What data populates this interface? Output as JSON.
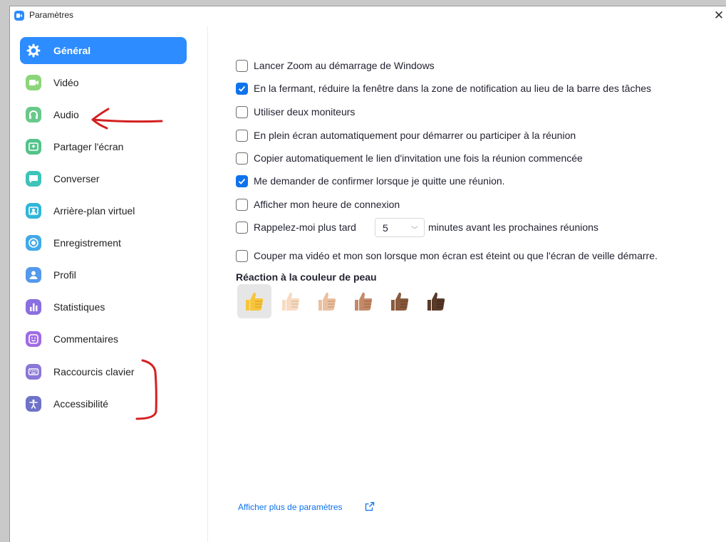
{
  "window": {
    "title": "Paramètres",
    "close_glyph": "✕"
  },
  "sidebar": {
    "items": [
      {
        "label": "Général",
        "icon": "gear-icon",
        "color": "#2d8cff",
        "active": true
      },
      {
        "label": "Vidéo",
        "icon": "video-camera-icon",
        "color": "#8dd57a"
      },
      {
        "label": "Audio",
        "icon": "headphones-icon",
        "color": "#67c98a"
      },
      {
        "label": "Partager l'écran",
        "icon": "share-screen-icon",
        "color": "#54c38a"
      },
      {
        "label": "Converser",
        "icon": "chat-bubble-icon",
        "color": "#3ec3b8"
      },
      {
        "label": "Arrière-plan virtuel",
        "icon": "virtual-background-icon",
        "color": "#31b6d8"
      },
      {
        "label": "Enregistrement",
        "icon": "record-icon",
        "color": "#42a9e8"
      },
      {
        "label": "Profil",
        "icon": "profile-icon",
        "color": "#5399ec"
      },
      {
        "label": "Statistiques",
        "icon": "statistics-icon",
        "color": "#8a6fe0"
      },
      {
        "label": "Commentaires",
        "icon": "feedback-smiley-icon",
        "color": "#9f6be4"
      },
      {
        "label": "Raccourcis clavier",
        "icon": "keyboard-icon",
        "color": "#8a77d8"
      },
      {
        "label": "Accessibilité",
        "icon": "accessibility-icon",
        "color": "#6f72c9"
      }
    ]
  },
  "general": {
    "options": [
      {
        "label": "Lancer Zoom au démarrage de Windows",
        "checked": false
      },
      {
        "label": "En la fermant, réduire la fenêtre dans la zone de notification au lieu de la barre des tâches",
        "checked": true
      },
      {
        "label": "Utiliser deux moniteurs",
        "checked": false
      },
      {
        "label": "En plein écran automatiquement pour démarrer ou participer à la réunion",
        "checked": false
      },
      {
        "label": "Copier automatiquement le lien d'invitation une fois la réunion commencée",
        "checked": false
      },
      {
        "label": "Me demander de confirmer lorsque je quitte une réunion.",
        "checked": true
      },
      {
        "label": "Afficher mon heure de connexion",
        "checked": false
      }
    ],
    "reminder": {
      "label_before": "Rappelez-moi plus tard",
      "select_value": "5",
      "label_after": "minutes avant les prochaines réunions",
      "checked": false
    },
    "mute_option": {
      "label": "Couper ma vidéo et mon son lorsque mon écran est éteint ou que l'écran de veille démarre.",
      "checked": false
    },
    "skin_tone": {
      "heading": "Réaction à la couleur de peau",
      "tones": [
        "#f7c53c",
        "#f7dbc2",
        "#eac0a0",
        "#c48a68",
        "#8a5a3c",
        "#5a3a28"
      ],
      "selected_index": 0
    },
    "more_settings_link": "Afficher plus de paramètres"
  },
  "annotations": {
    "color": "#d42020"
  }
}
